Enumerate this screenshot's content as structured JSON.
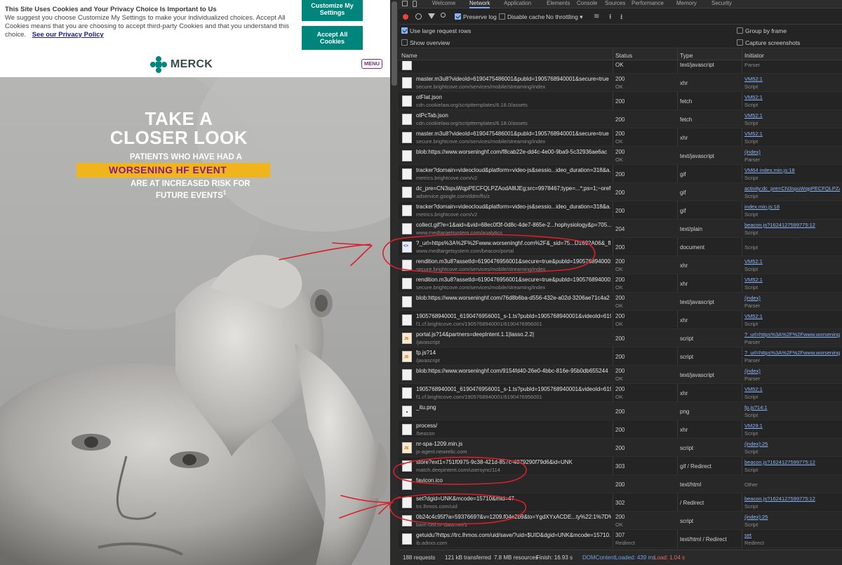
{
  "cookie": {
    "title": "This Site Uses Cookies and Your Privacy Choice Is Important to Us",
    "body": "We suggest you choose Customize My Settings to make your individualized choices. Accept All Cookies means that you are choosing to accept third-party Cookies and that you understand this choice.",
    "privacy_link": "See our Privacy Policy",
    "customize_label": "Customize My Settings",
    "accept_label": "Accept All Cookies"
  },
  "site": {
    "logo_text": "MERCK",
    "menu_label": "MENU",
    "headline_1": "TAKE A",
    "headline_2": "CLOSER LOOK",
    "sub1": "PATIENTS WHO HAVE HAD A",
    "highlight": "WORSENING HF EVENT",
    "sub2": "ARE AT INCREASED RISK FOR",
    "sub3": "FUTURE EVENTS",
    "sub3_sup": "1",
    "colors": {
      "teal": "#00857c",
      "purple": "#8a1a7f",
      "yellow": "#f0b41c"
    }
  },
  "devtools": {
    "tabs": [
      "Welcome",
      "Network",
      "Application",
      "Elements",
      "Console",
      "Sources",
      "Performance",
      "Memory",
      "Security"
    ],
    "active_tab": "Network",
    "toolbar": {
      "preserve_log": "Preserve log",
      "disable_cache": "Disable cache",
      "throttling": "No throttling"
    },
    "options": {
      "large_rows": "Use large request rows",
      "overview": "Show overview",
      "group_frame": "Group by frame",
      "capture": "Capture screenshots"
    },
    "columns": {
      "name": "Name",
      "status": "Status",
      "type": "Type",
      "initiator": "Initiator"
    },
    "rows": [
      {
        "name": "",
        "domain": "",
        "status": "OK",
        "status2": "",
        "type": "text/javascript",
        "init": "",
        "init2": "Parser",
        "icon": "file"
      },
      {
        "name": "master.m3u8?videoId=6190475486001&pubId=1905768940001&secure=true",
        "domain": "secure.brightcove.com/services/mobile/streaming/index",
        "status": "200",
        "status2": "OK",
        "type": "xhr",
        "init": "VM52:1",
        "init2": "Script",
        "icon": "file"
      },
      {
        "name": "otFlat.json",
        "domain": "cdn.cookielaw.org/scripttemplates/6.18.0/assets",
        "status": "200",
        "status2": "",
        "type": "fetch",
        "init": "VM52:1",
        "init2": "Script",
        "icon": "file"
      },
      {
        "name": "otPcTab.json",
        "domain": "cdn.cookielaw.org/scripttemplates/6.18.0/assets",
        "status": "200",
        "status2": "",
        "type": "fetch",
        "init": "VM52:1",
        "init2": "Script",
        "icon": "file"
      },
      {
        "name": "master.m3u8?videoId=6190475486001&pubId=1905768940001&secure=true",
        "domain": "secure.brightcove.com/services/mobile/streaming/index",
        "status": "200",
        "status2": "OK",
        "type": "xhr",
        "init": "VM52:1",
        "init2": "Script",
        "icon": "file"
      },
      {
        "name": "blob:https://www.worseninghf.com/f8cab22e-dd4c-4e00-9ba9-5c32936ae6ac",
        "domain": "",
        "status": "200",
        "status2": "OK",
        "type": "text/javascript",
        "init": "(index)",
        "init2": "Parser",
        "icon": "file"
      },
      {
        "name": "tracker?domain=videocloud&platform=video-js&sessio...ideo_duration=318&a...",
        "domain": "metrics.brightcove.com/v2",
        "status": "200",
        "status2": "",
        "type": "gif",
        "init": "VM64 index.min.js:18",
        "init2": "Script",
        "icon": "file"
      },
      {
        "name": "dc_pre=CN3spuWqpPECFQLPZAodA8lJEg;src=9978467;type=...*;ps=1;~oref=htt...",
        "domain": "adservice.google.com/ddm/fls/z",
        "status": "200",
        "status2": "",
        "type": "gif",
        "init": "activity;dc_pre=CN3spuWqpPECFQLPZA",
        "init2": "Script",
        "icon": "file"
      },
      {
        "name": "tracker?domain=videocloud&platform=video-js&sessio...ideo_duration=318&a...",
        "domain": "metrics.brightcove.com/v2",
        "status": "200",
        "status2": "",
        "type": "gif",
        "init": "index.min.js:18",
        "init2": "Script",
        "icon": "file"
      },
      {
        "name": "collect.gif?e=1&aid=&vid=68ec0f3f-0d8c-4de7-865e-2...hophysiology&p=705...",
        "domain": "www.medtargetsystem.com/analytics",
        "status": "204",
        "status2": "",
        "type": "text/plain",
        "init": "beacon.js?1624127599775:12",
        "init2": "Script",
        "icon": "file"
      },
      {
        "name": "?_url=https%3A%2F%2Fwww.worseninghf.com%2F&_sid=75...D1692A06&_flash...",
        "domain": "www.medtargetsystem.com/beacon/portal",
        "status": "200",
        "status2": "",
        "type": "document",
        "init": "",
        "init2": "Script",
        "icon": "doc"
      },
      {
        "name": "rendition.m3u8?assetId=6190476956001&secure=true&pubId=1905768940001...",
        "domain": "secure.brightcove.com/services/mobile/streaming/index",
        "status": "200",
        "status2": "OK",
        "type": "xhr",
        "init": "VM52:1",
        "init2": "Script",
        "icon": "file"
      },
      {
        "name": "rendition.m3u8?assetId=6190476956001&secure=true&pubId=1905768940001...",
        "domain": "secure.brightcove.com/services/mobile/streaming/index",
        "status": "200",
        "status2": "OK",
        "type": "xhr",
        "init": "VM52:1",
        "init2": "Script",
        "icon": "file"
      },
      {
        "name": "blob:https://www.worseninghf.com/76d8b6ba-d556-432e-a02d-3206ae71c4a2",
        "domain": "",
        "status": "200",
        "status2": "OK",
        "type": "text/javascript",
        "init": "(index)",
        "init2": "Parser",
        "icon": "file"
      },
      {
        "name": "1905768940001_6190476956001_s-1.ts?pubId=1905768940001&videoId=6190...",
        "domain": "f1.cf.brightcove.com/1905768940001/6190476956001",
        "status": "200",
        "status2": "OK",
        "type": "xhr",
        "init": "VM52:1",
        "init2": "Script",
        "icon": "file"
      },
      {
        "name": "portal.js?14&partners=deepIntent.1.1|lasso.2.2|",
        "domain": "/javascript",
        "status": "200",
        "status2": "",
        "type": "script",
        "init": "?_url=https%3A%2F%2Fwww.worseninghf",
        "init2": "Parser",
        "icon": "js"
      },
      {
        "name": "fp.js?14",
        "domain": "/javascript",
        "status": "200",
        "status2": "",
        "type": "script",
        "init": "?_url=https%3A%2F%2Fwww.worseninghf",
        "init2": "Parser",
        "icon": "js"
      },
      {
        "name": "blob:https://www.worseninghf.com/9154fd40-26e0-4bbc-816e-95b0db655244",
        "domain": "",
        "status": "200",
        "status2": "OK",
        "type": "text/javascript",
        "init": "(index)",
        "init2": "Parser",
        "icon": "file"
      },
      {
        "name": "1905768940001_6190476956001_s-1.ts?pubId=1905768940001&videoId=6190...",
        "domain": "f1.cf.brightcove.com/1905768940001/6190476956001",
        "status": "200",
        "status2": "OK",
        "type": "xhr",
        "init": "VM52:1",
        "init2": "Script",
        "icon": "file"
      },
      {
        "name": "_itu.png",
        "domain": "",
        "status": "200",
        "status2": "",
        "type": "png",
        "init": "fp.js?14:1",
        "init2": "Script",
        "icon": "img"
      },
      {
        "name": "process/",
        "domain": "/beacon",
        "status": "200",
        "status2": "",
        "type": "xhr",
        "init": "VM29:1",
        "init2": "Script",
        "icon": "file"
      },
      {
        "name": "nr-spa-1209.min.js",
        "domain": "js-agent.newrelic.com",
        "status": "200",
        "status2": "",
        "type": "script",
        "init": "(index):25",
        "init2": "Script",
        "icon": "js"
      },
      {
        "name": "store?ext1=751f0975-9c38-421d-857c-4879290f79d6&id=UNK",
        "domain": "match.deepintent.com/usersync/114",
        "status": "303",
        "status2": "",
        "type": "gif / Redirect",
        "init": "beacon.js?1624127599775:12",
        "init2": "Script",
        "icon": "file"
      },
      {
        "name": "favicon.ico",
        "domain": "",
        "status": "200",
        "status2": "",
        "type": "text/html",
        "init": "",
        "init2": "Other",
        "icon": "file"
      },
      {
        "name": "set?dgid=UNK&mcode=15710&mid=47",
        "domain": "trc.lhmos.com/uid",
        "status": "302",
        "status2": "",
        "type": "/ Redirect",
        "init": "beacon.js?1624127599775:12",
        "init2": "Script",
        "icon": "file"
      },
      {
        "name": "0b24c4c95f?a=5937669?&v=1209.f04e2b9&to=YgdXYxACDE...ty%22:1%7D%7...",
        "domain": "bam-cell.nr-data.net/1",
        "status": "200",
        "status2": "OK",
        "type": "script",
        "init": "(index):25",
        "init2": "Script",
        "icon": "file"
      },
      {
        "name": "getuidu?https://trc.lhmos.com/uid/save/?uid=$UID&dgid=UNK&mcode=15710...",
        "domain": "ib.adnxs.com",
        "status": "307",
        "status2": "Redirect",
        "type": "text/html / Redirect",
        "init": "set",
        "init2": "Redirect",
        "icon": "file"
      }
    ],
    "status_bar": {
      "requests": "188 requests",
      "transferred": "121 kB transferred",
      "resources": "7.8 MB resources",
      "finish": "Finish: 16.93 s",
      "dcl": "DOMContentLoaded: 439 ms",
      "load": "Load: 1.04 s"
    }
  }
}
